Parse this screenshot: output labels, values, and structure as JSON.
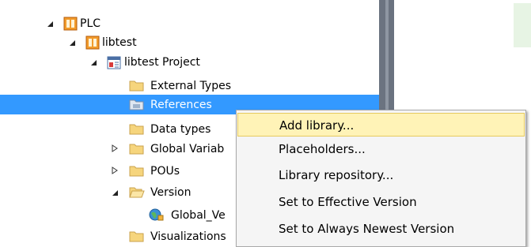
{
  "tree": {
    "nodes": [
      {
        "label": "PLC",
        "icon": "plc-device-icon",
        "arrow": "expanded"
      },
      {
        "label": "libtest",
        "icon": "plc-device-icon",
        "arrow": "expanded"
      },
      {
        "label": "libtest Project",
        "icon": "project-icon",
        "arrow": "expanded"
      },
      {
        "label": "External Types",
        "icon": "folder-icon",
        "arrow": "none"
      },
      {
        "label": "References",
        "icon": "references-folder-icon",
        "arrow": "none",
        "selected": true
      },
      {
        "label": "Data types",
        "icon": "folder-icon",
        "arrow": "none"
      },
      {
        "label": "Global Variab",
        "icon": "folder-icon",
        "arrow": "collapsed"
      },
      {
        "label": "POUs",
        "icon": "folder-icon",
        "arrow": "collapsed"
      },
      {
        "label": "Version",
        "icon": "open-folder-icon",
        "arrow": "expanded"
      },
      {
        "label": "Global_Ve",
        "icon": "global-version-icon",
        "arrow": "none"
      },
      {
        "label": "Visualizations",
        "icon": "folder-icon",
        "arrow": "none"
      }
    ]
  },
  "context_menu": {
    "items": [
      {
        "label": "Add library...",
        "highlighted": true
      },
      {
        "label": "Placeholders..."
      },
      {
        "label": "Library repository..."
      },
      {
        "label": "Set to Effective Version"
      },
      {
        "label": "Set to Always Newest Version"
      }
    ]
  },
  "colors": {
    "selection": "#3399ff",
    "menu_highlight": "#fff3b7",
    "menu_background": "#f5f5f5",
    "splitter": "#6b7380"
  }
}
